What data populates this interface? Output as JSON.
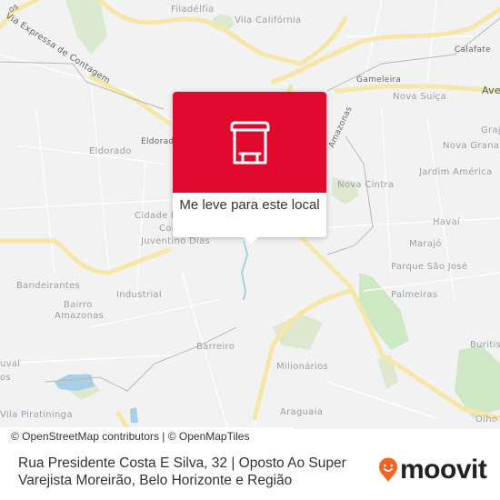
{
  "map": {
    "labels": {
      "via_expressa": "Via Expressa de Contagem",
      "filadelfia": "Filadélfia",
      "vila_california": "Vila Califórnia",
      "calafate": "Calafate",
      "gameleira": "Gameleira",
      "nova_suica": "Nova Suíça",
      "avenida": "Ave",
      "amazonas": "Amazonas",
      "grajau": "Graj",
      "nova_granada": "Nova Grana",
      "eldorado_small": "Eldorado",
      "eldorado": "Eldorado",
      "jardim_america": "Jardim América",
      "nova_cintra": "Nova Cintra",
      "cidade_industrial_1": "Cidade I",
      "cidade_industrial_2": "Cor",
      "juventino_dias": "Juventino Dias",
      "havai": "Havaí",
      "marajo": "Marajó",
      "bandeirantes": "Bandeirantes",
      "parque_sao_jose": "Parque São José",
      "industrial": "Industrial",
      "palmeiras": "Palmeiras",
      "bairro_amazonas_1": "Bairro",
      "bairro_amazonas_2": "Amazonas",
      "barreiro": "Barreiro",
      "buritis": "Buritis",
      "juval_1": "uval",
      "juval_2": "os",
      "milionarios": "Milionários",
      "vila_piratininga": "Vila Piratininga",
      "araguaia": "Araguaia",
      "olhos": "Olho",
      "os_top": "os"
    }
  },
  "popup": {
    "icon": "bus-stop-icon",
    "action_label": "Me leve para este local",
    "accent_color": "#e2092f"
  },
  "attribution": "© OpenStreetMap contributors | © OpenMapTiles",
  "footer": {
    "address": "Rua Presidente Costa E Silva, 32 | Oposto Ao Super Varejista Moreirão, Belo Horizonte e Região",
    "logo_text": "moovit",
    "logo_color": "#f26522"
  }
}
